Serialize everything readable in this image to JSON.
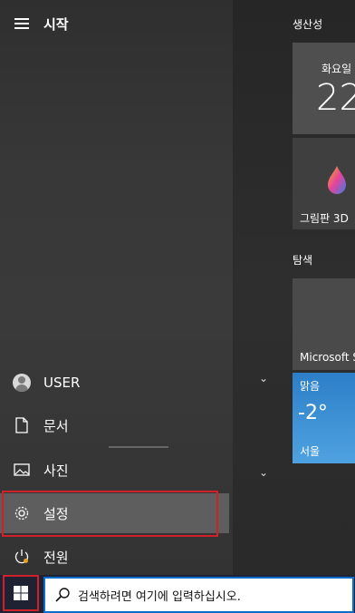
{
  "start": {
    "title": "시작"
  },
  "nav": {
    "user": "USER",
    "documents": "문서",
    "pictures": "사진",
    "settings": "설정",
    "power": "전원"
  },
  "tiles": {
    "productivity_header": "생산성",
    "calendar_day": "화요일",
    "calendar_date": "22",
    "paint3d": "그림판 3D",
    "explore_header": "탐색",
    "store": "Microsoft S",
    "weather_condition": "맑음",
    "weather_temp": "-2°",
    "weather_city": "서울"
  },
  "taskbar": {
    "search_placeholder": "검색하려면 여기에 입력하십시오."
  },
  "colors": {
    "highlight_outline": "#d0202a",
    "search_border": "#0a6ecb",
    "taskbar": "#1f2233"
  }
}
